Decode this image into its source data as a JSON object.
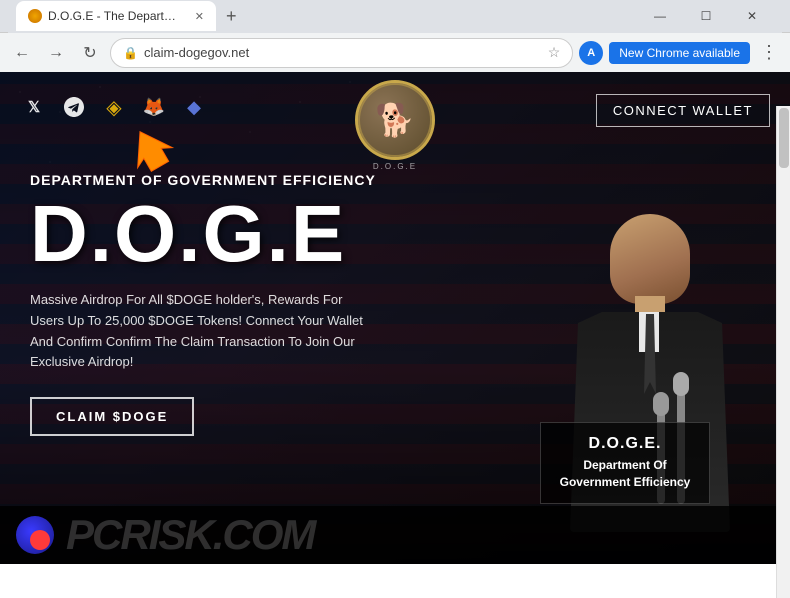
{
  "browser": {
    "tab_title": "D.O.G.E - The Department of G...",
    "url": "claim-dogegov.net",
    "new_chrome_label": "New Chrome available",
    "window_controls": {
      "minimize": "—",
      "maximize": "☐",
      "close": "✕"
    }
  },
  "toolbar": {
    "back": "←",
    "forward": "→",
    "reload": "↻",
    "star": "☆",
    "profile_initial": "A"
  },
  "site": {
    "nav": {
      "connect_wallet": "CONNECT WALLET",
      "social_icons": [
        "X",
        "✈",
        "◈",
        "⬡",
        "◆"
      ]
    },
    "hero": {
      "dept_label": "DEPARTMENT OF GOVERNMENT EFFICIENCY",
      "main_title": "D.O.G.E",
      "description": "Massive Airdrop For All $DOGE holder's, Rewards For Users Up To 25,000 $DOGE Tokens! Connect Your Wallet And Confirm Confirm The Claim Transaction To Join Our Exclusive Airdrop!",
      "claim_button": "CLAIM $DOGE"
    },
    "podium": {
      "title": "D.O.G.E.",
      "subtitle": "Department Of\nGovernment Efficiency"
    },
    "watermark": "RISK.COM"
  }
}
